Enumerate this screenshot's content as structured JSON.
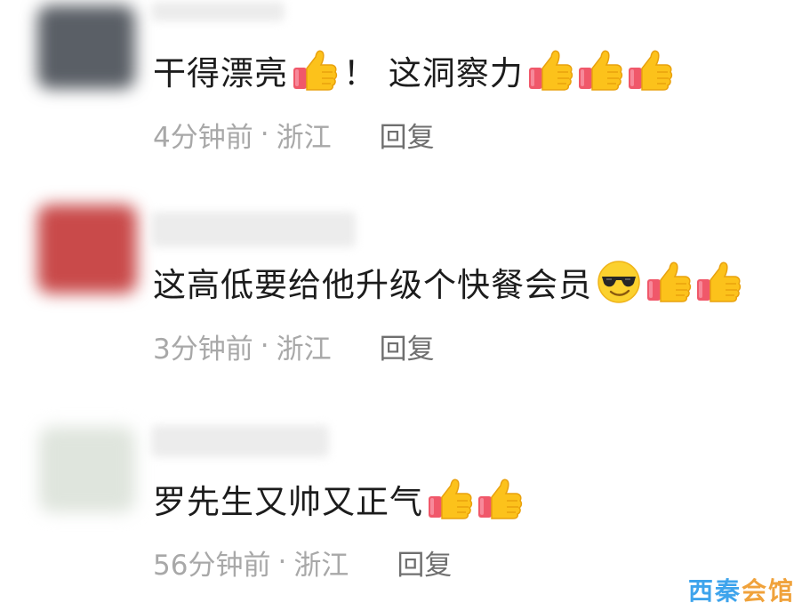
{
  "comments": [
    {
      "text_a": "干得漂亮",
      "text_b": "！ 这洞察力",
      "time": "4分钟前",
      "sep": "·",
      "location": "浙江",
      "reply": "回复",
      "avatar_color": "#5a5f66"
    },
    {
      "text": "这高低要给他升级个快餐会员",
      "time": "3分钟前",
      "sep": "·",
      "location": "浙江",
      "reply": "回复",
      "avatar_color": "#c94a4a"
    },
    {
      "text": "罗先生又帅又正气",
      "time": "56分钟前",
      "sep": "·",
      "location": "浙江",
      "reply": "回复",
      "avatar_color": "#dfe5dd"
    }
  ],
  "icons": {
    "thumbs_up": "thumbs-up-icon",
    "cool_face": "cool-face-icon"
  },
  "colors": {
    "text": "#1c1c1c",
    "meta": "#a8a8a8",
    "reply": "#6f6f6f",
    "thumb_yellow": "#fcc21b",
    "thumb_sleeve": "#f0586a",
    "watermark_blue": "#3ea4ec",
    "watermark_orange": "#f0a23b"
  },
  "watermark": {
    "part1": "西秦",
    "part2": "会馆"
  }
}
